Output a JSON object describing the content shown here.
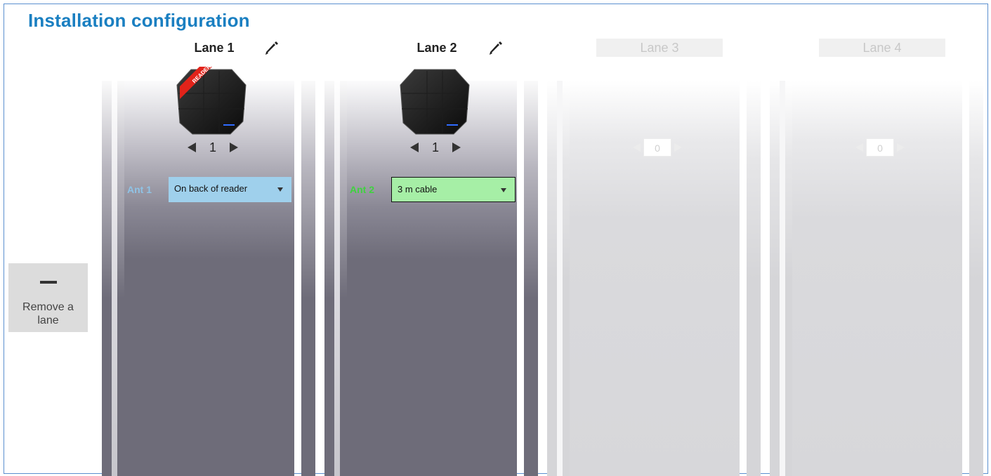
{
  "page": {
    "title": "Installation configuration"
  },
  "remove_lane": {
    "label": "Remove a lane",
    "icon": "minus-icon"
  },
  "lanes": [
    {
      "title": "Lane 1",
      "enabled": true,
      "badge": "READER",
      "reader_count": "1",
      "antenna": {
        "label": "Ant 1",
        "value": "On back of reader",
        "label_color": "#8fc3e6",
        "select_bg": "#9fd0ec"
      }
    },
    {
      "title": "Lane 2",
      "enabled": true,
      "reader_count": "1",
      "antenna": {
        "label": "Ant 2",
        "value": "3 m cable",
        "label_color": "#3fd23f",
        "select_bg": "#a6efa6"
      }
    },
    {
      "title": "Lane 3",
      "enabled": false,
      "reader_count": "0"
    },
    {
      "title": "Lane 4",
      "enabled": false,
      "reader_count": "0"
    }
  ],
  "colors": {
    "title": "#1a7fc1",
    "active_panel": "#6e6c79",
    "disabled_panel": "#d7d7da"
  }
}
